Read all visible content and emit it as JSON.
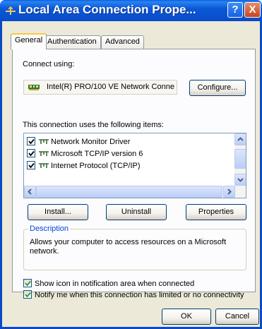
{
  "window": {
    "title": "Local Area Connection Prope...",
    "help_button": "?",
    "close_button": "X"
  },
  "tabs": [
    {
      "label": "General",
      "active": true
    },
    {
      "label": "Authentication",
      "active": false
    },
    {
      "label": "Advanced",
      "active": false
    }
  ],
  "general": {
    "connect_using_label": "Connect using:",
    "adapter_name": "Intel(R) PRO/100 VE Network Conne",
    "configure_button": "Configure...",
    "items_label": "This connection uses the following items:",
    "items": [
      {
        "label": "Network Monitor Driver",
        "checked": true
      },
      {
        "label": "Microsoft TCP/IP version 6",
        "checked": true
      },
      {
        "label": "Internet Protocol (TCP/IP)",
        "checked": true
      }
    ],
    "install_button": "Install...",
    "uninstall_button": "Uninstall",
    "properties_button": "Properties",
    "description_title": "Description",
    "description_text": "Allows your computer to access resources on a Microsoft network.",
    "show_icon_label": "Show icon in notification area when connected",
    "show_icon_checked": true,
    "notify_label": "Notify me when this connection has limited or no connectivity",
    "notify_checked": true
  },
  "footer": {
    "ok_button": "OK",
    "cancel_button": "Cancel"
  }
}
